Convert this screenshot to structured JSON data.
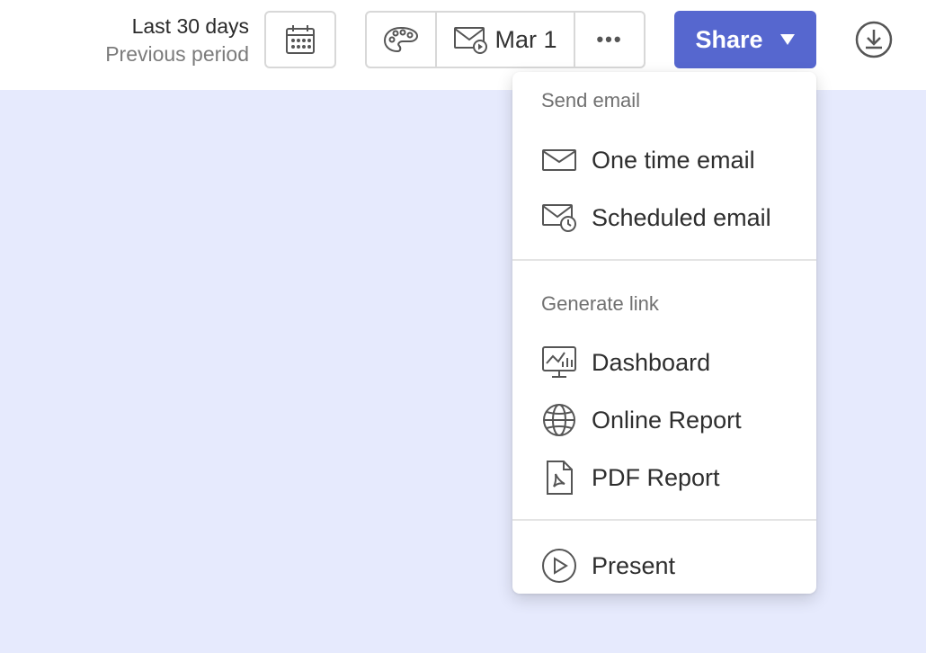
{
  "header": {
    "period_primary": "Last 30 days",
    "period_secondary": "Previous period",
    "scheduled_date": "Mar 1",
    "more_label": "•••",
    "share_label": "Share"
  },
  "share_menu": {
    "send_email_title": "Send email",
    "send_email_items": [
      {
        "label": "One time email",
        "icon": "envelope-icon"
      },
      {
        "label": "Scheduled email",
        "icon": "envelope-clock-icon"
      }
    ],
    "generate_link_title": "Generate link",
    "generate_link_items": [
      {
        "label": "Dashboard",
        "icon": "monitor-chart-icon"
      },
      {
        "label": "Online Report",
        "icon": "globe-icon"
      },
      {
        "label": "PDF Report",
        "icon": "pdf-file-icon"
      }
    ],
    "present_items": [
      {
        "label": "Present",
        "icon": "play-circle-icon"
      }
    ]
  },
  "colors": {
    "accent": "#5667cf",
    "canvas_background": "#e6eafd",
    "topbar_background": "#ffffff"
  }
}
